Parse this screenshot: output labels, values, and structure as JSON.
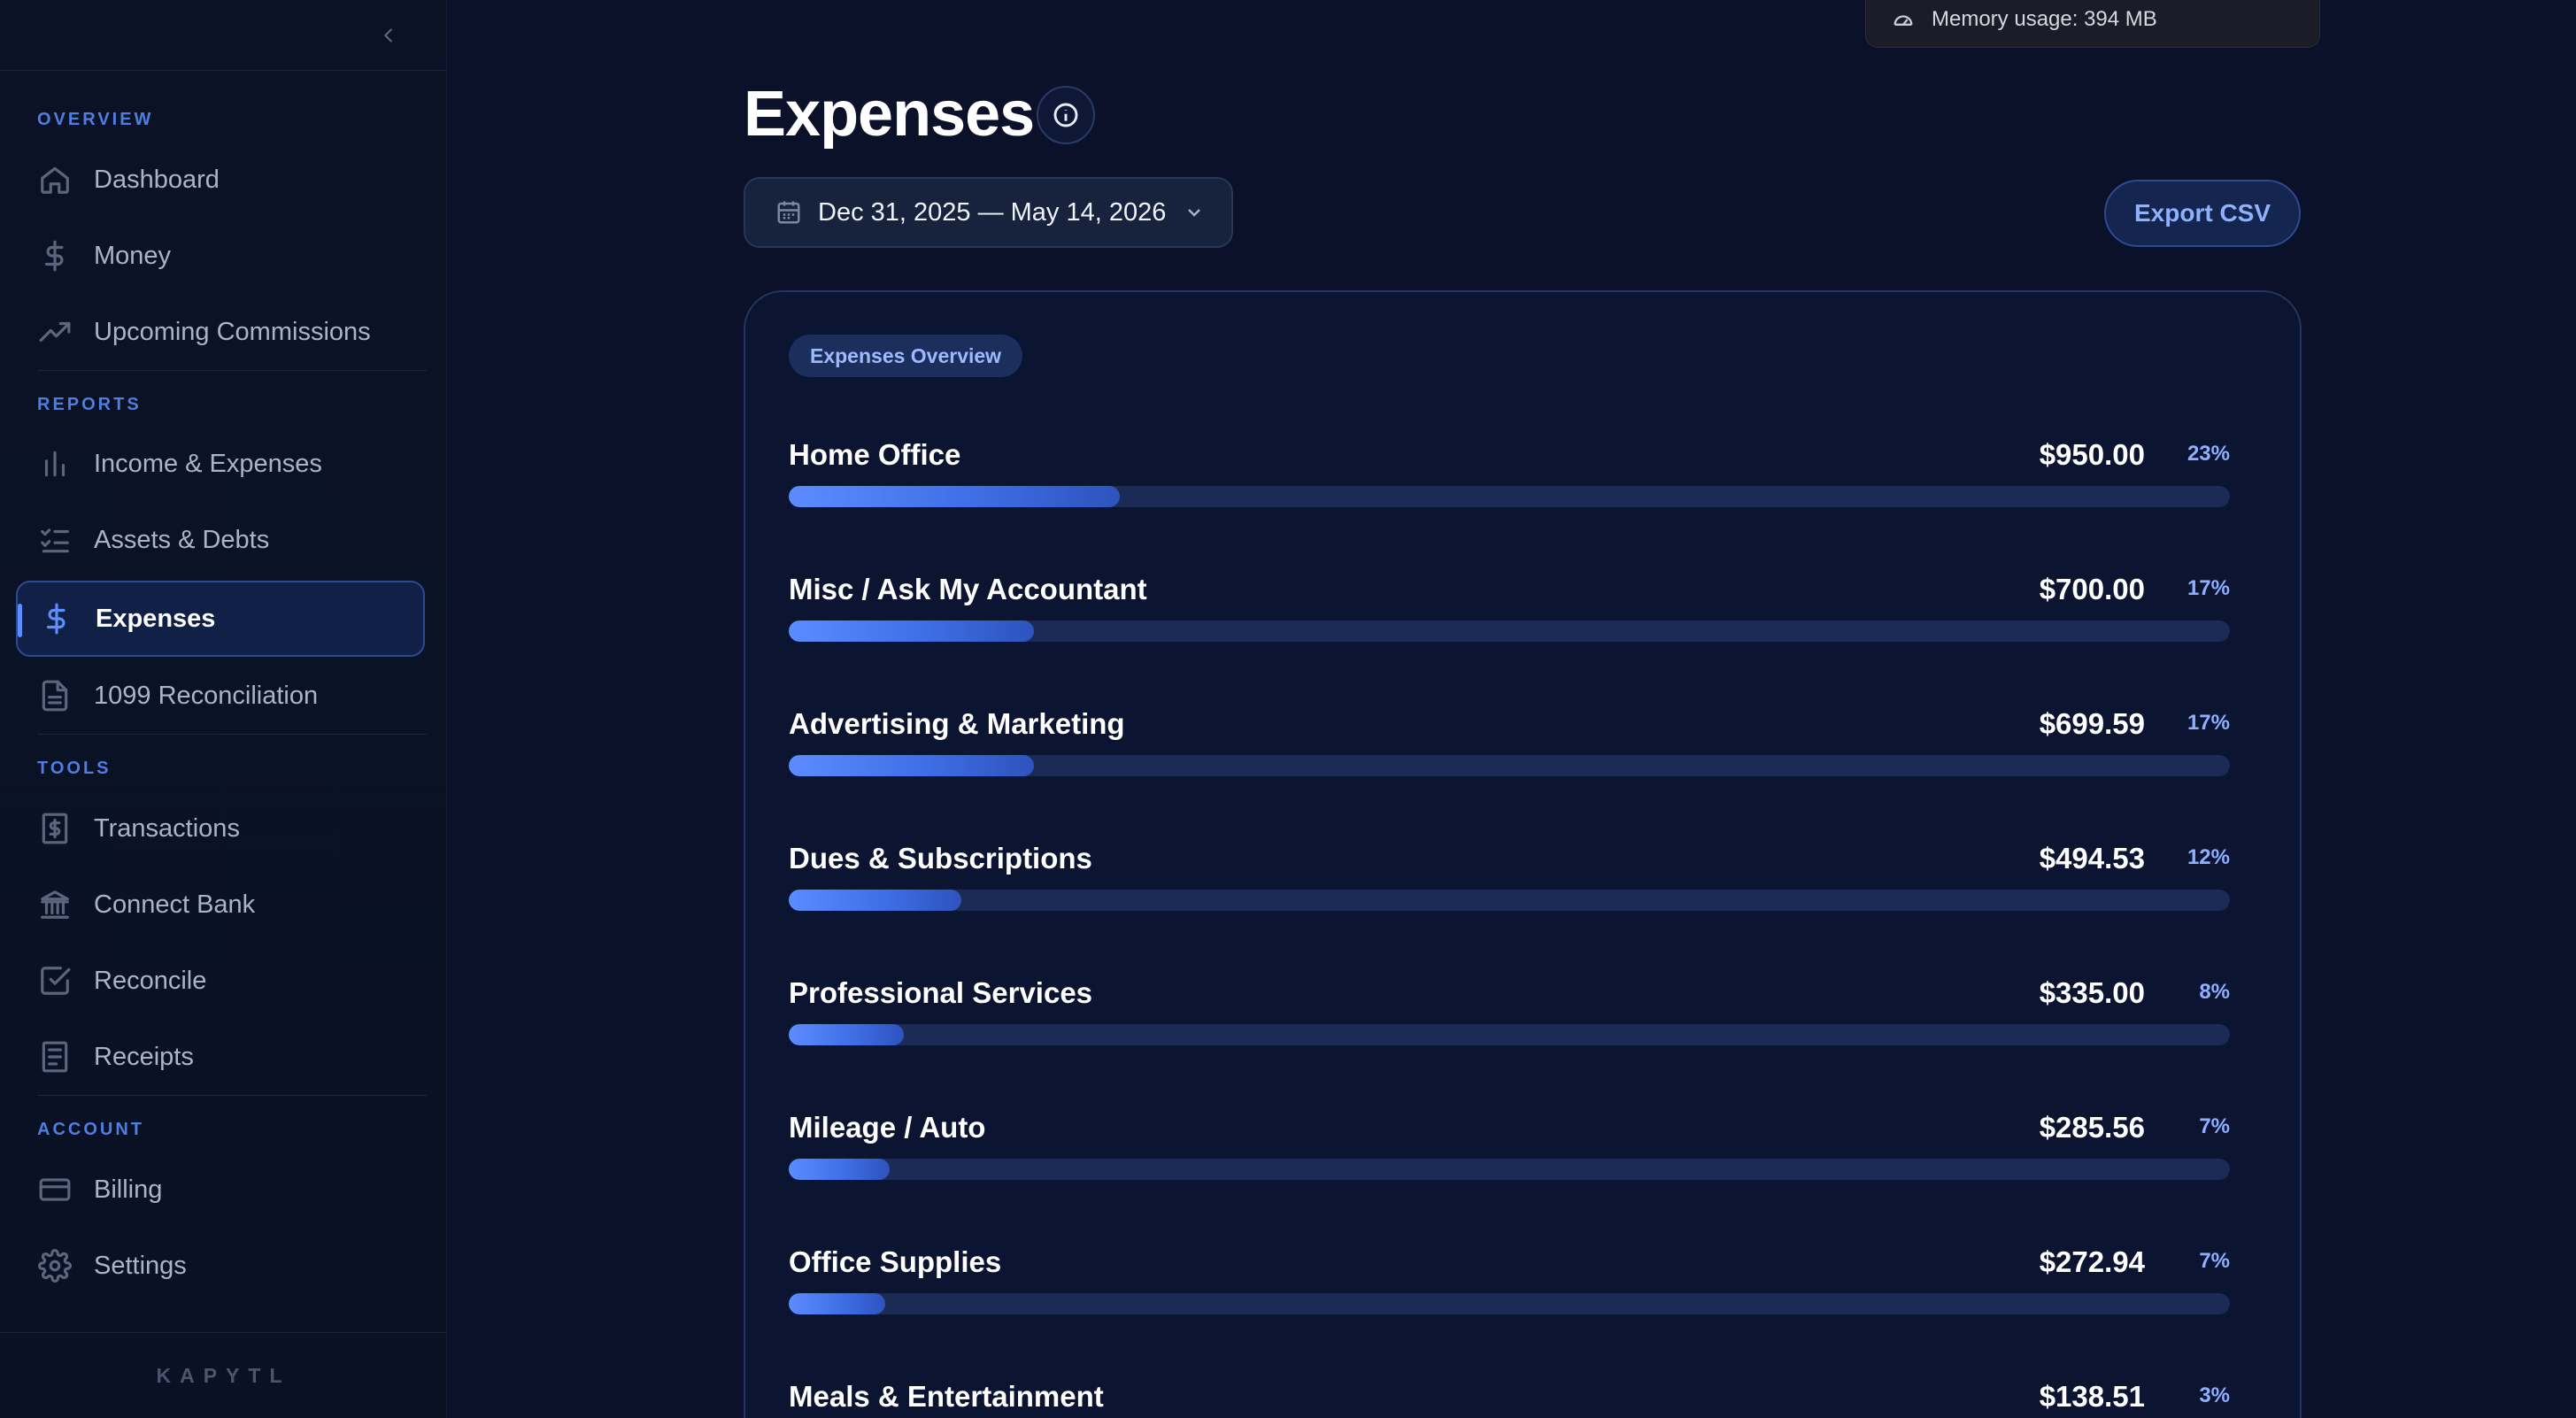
{
  "memory": {
    "label": "Memory usage: 394 MB"
  },
  "sidebar": {
    "sections": {
      "overview": "OVERVIEW",
      "reports": "REPORTS",
      "tools": "TOOLS",
      "account": "ACCOUNT"
    },
    "items": [
      {
        "label": "Dashboard",
        "icon": "home-icon"
      },
      {
        "label": "Money",
        "icon": "dollar-icon"
      },
      {
        "label": "Upcoming Commissions",
        "icon": "trending-up-icon"
      },
      {
        "label": "Income & Expenses",
        "icon": "bar-chart-icon"
      },
      {
        "label": "Assets & Debts",
        "icon": "list-checks-icon"
      },
      {
        "label": "Expenses",
        "icon": "dollar-icon",
        "active": true
      },
      {
        "label": "1099 Reconciliation",
        "icon": "file-text-icon"
      },
      {
        "label": "Transactions",
        "icon": "receipt-dollar-icon"
      },
      {
        "label": "Connect Bank",
        "icon": "bank-icon"
      },
      {
        "label": "Reconcile",
        "icon": "check-square-icon"
      },
      {
        "label": "Receipts",
        "icon": "receipt-icon"
      },
      {
        "label": "Billing",
        "icon": "credit-card-icon"
      },
      {
        "label": "Settings",
        "icon": "gear-icon"
      }
    ],
    "brand": "KAPYTL"
  },
  "header": {
    "title": "Expenses",
    "date_range": "Dec 31, 2025 — May 14, 2026",
    "export_label": "Export CSV"
  },
  "overview": {
    "badge": "Expenses Overview",
    "items": [
      {
        "name": "Home Office",
        "amount": "$950.00",
        "percent": "23%",
        "share": 0.23
      },
      {
        "name": "Misc / Ask My Accountant",
        "amount": "$700.00",
        "percent": "17%",
        "share": 0.17
      },
      {
        "name": "Advertising & Marketing",
        "amount": "$699.59",
        "percent": "17%",
        "share": 0.17
      },
      {
        "name": "Dues & Subscriptions",
        "amount": "$494.53",
        "percent": "12%",
        "share": 0.12
      },
      {
        "name": "Professional Services",
        "amount": "$335.00",
        "percent": "8%",
        "share": 0.08
      },
      {
        "name": "Mileage / Auto",
        "amount": "$285.56",
        "percent": "7%",
        "share": 0.07
      },
      {
        "name": "Office Supplies",
        "amount": "$272.94",
        "percent": "7%",
        "share": 0.067
      },
      {
        "name": "Meals & Entertainment",
        "amount": "$138.51",
        "percent": "3%",
        "share": 0.03
      }
    ]
  },
  "colors": {
    "background": "#0a1128",
    "accent": "#5e8dff",
    "bar_track": "#1b2b55"
  }
}
